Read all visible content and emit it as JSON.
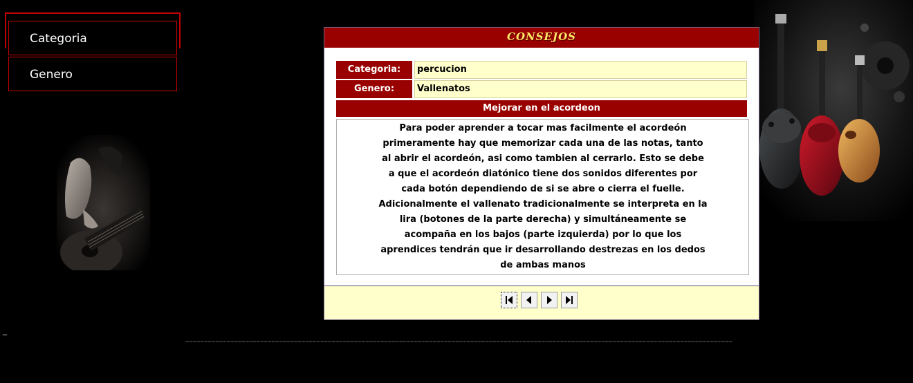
{
  "menu": {
    "items": [
      {
        "label": "Categoria"
      },
      {
        "label": "Genero"
      }
    ]
  },
  "panel": {
    "title": "CONSEJOS",
    "fields": [
      {
        "label": "Categoria:",
        "value": "percucion"
      },
      {
        "label": "Genero:",
        "value": "Vallenatos"
      }
    ],
    "heading": "Mejorar en el acordeon",
    "body": "Para poder aprender a tocar mas facilmente el acordeón primeramente hay que memorizar cada una de las notas, tanto al abrir el acordeón, asi como tambien al cerrarlo. Esto se debe a que el acordeón diatónico tiene dos sonidos diferentes por cada botón dependiendo de si se abre o cierra el fuelle. Adicionalmente el vallenato tradicionalmente se interpreta en la lira (botones de la parte derecha) y simultáneamente se acompaña en los bajos (parte izquierda) por lo que los aprendices tendrán que ir desarrollando destrezas en los dedos de ambas manos",
    "nav": {
      "first_icon": "first-page-icon",
      "prev_icon": "previous-page-icon",
      "next_icon": "next-page-icon",
      "last_icon": "last-page-icon"
    }
  },
  "footer": {
    "dash": "_",
    "tilde_line": "~~~~~~~~~~~~~~~~~~~~~~~~~~~~~~~~~~~~~~~~~~~~~~~~~~~~~~~~~~~~~~~~~~~~~~~~~~~~~~~~~~~~~~~~~~~~~~~~~~~~~~~~~~~~~~~~~~~~~~~~~~~~~~~~~~~~~~~~~~~~~~~~~~"
  },
  "colors": {
    "accent_red": "#990000",
    "menu_border": "#c40000",
    "title_text": "#ffe866",
    "cell_background": "#ffffcc"
  }
}
